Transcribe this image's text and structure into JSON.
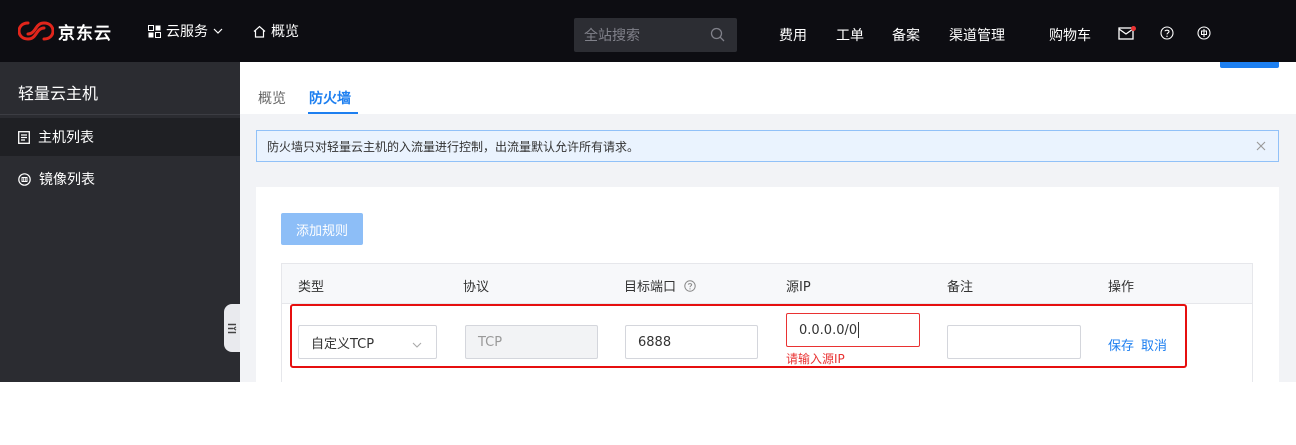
{
  "brand": {
    "logo_text": "京东云"
  },
  "topnav": {
    "cloud_services": "云服务",
    "overview": "概览",
    "search_placeholder": "全站搜索",
    "links": [
      "费用",
      "工单",
      "备案",
      "渠道管理",
      "购物车"
    ]
  },
  "sidebar": {
    "title": "轻量云主机",
    "items": [
      {
        "label": "主机列表",
        "icon": "list-icon"
      },
      {
        "label": "镜像列表",
        "icon": "image-icon"
      }
    ]
  },
  "tabs": [
    {
      "label": "概览"
    },
    {
      "label": "防火墙"
    }
  ],
  "notice": {
    "text": "防火墙只对轻量云主机的入流量进行控制，出流量默认允许所有请求。"
  },
  "firewall": {
    "add_button": "添加规则",
    "columns": [
      "类型",
      "协议",
      "目标端口",
      "源IP",
      "备注",
      "操作"
    ],
    "row": {
      "type": "自定义TCP",
      "protocol": "TCP",
      "port": "6888",
      "source_ip": "0.0.0.0/0",
      "source_ip_error": "请输入源IP",
      "remark": "",
      "save": "保存",
      "cancel": "取消"
    }
  },
  "colors": {
    "topbar": "#0d0d12",
    "sidebar": "#2b2c31",
    "accent": "#1d7ff0",
    "error": "#e93232",
    "highlight": "#e60f0f"
  }
}
